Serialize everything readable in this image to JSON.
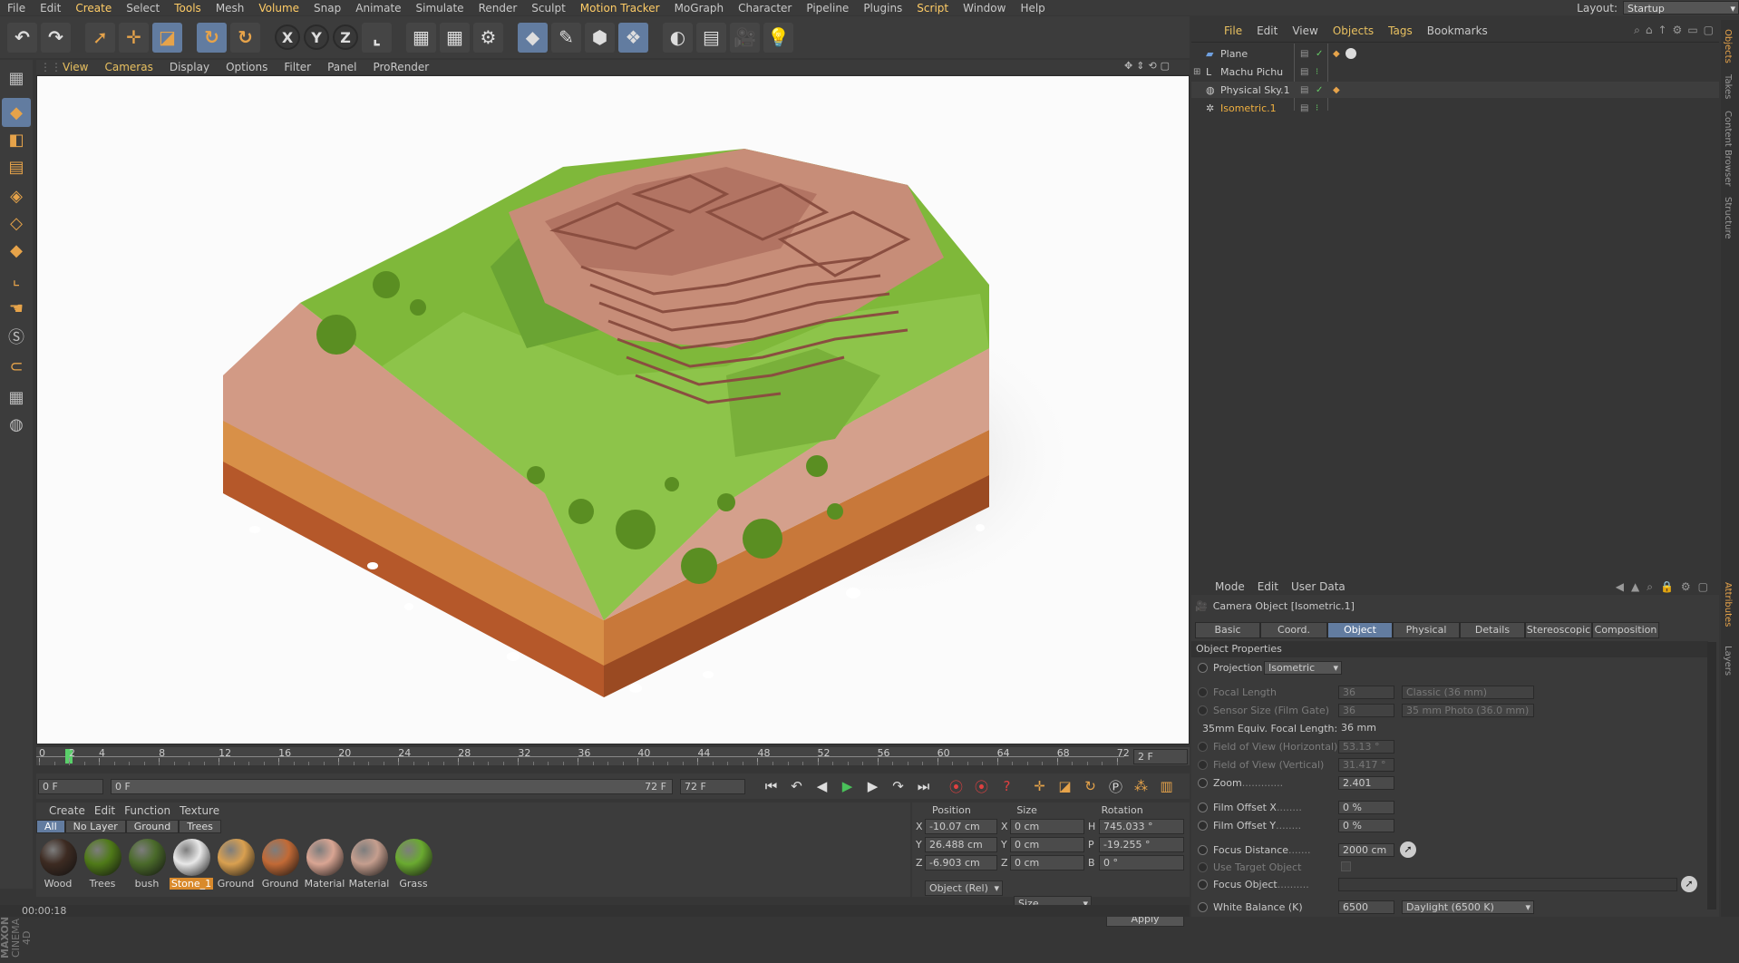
{
  "menubar": {
    "items": [
      "File",
      "Edit",
      "Create",
      "Select",
      "Tools",
      "Mesh",
      "Volume",
      "Snap",
      "Animate",
      "Simulate",
      "Render",
      "Sculpt",
      "Motion Tracker",
      "MoGraph",
      "Character",
      "Pipeline",
      "Plugins",
      "Script",
      "Window",
      "Help"
    ],
    "highlighted": [
      "Create",
      "Tools",
      "Volume",
      "Motion Tracker",
      "Script"
    ],
    "layout_label": "Layout:",
    "layout_value": "Startup"
  },
  "toolbar": {
    "buttons": [
      {
        "name": "undo-icon",
        "glyph": "↶"
      },
      {
        "name": "redo-icon",
        "glyph": "↷"
      },
      {
        "name": "live-selection-icon",
        "glyph": "➚"
      },
      {
        "name": "move-icon",
        "glyph": "✛"
      },
      {
        "name": "scale-icon",
        "glyph": "◪"
      },
      {
        "name": "rotate-icon",
        "glyph": "↻"
      },
      {
        "name": "recent-tool-icon",
        "glyph": "↻"
      },
      {
        "name": "x-axis-icon",
        "glyph": "X"
      },
      {
        "name": "y-axis-icon",
        "glyph": "Y"
      },
      {
        "name": "z-axis-icon",
        "glyph": "Z"
      },
      {
        "name": "coordinate-system-icon",
        "glyph": "⌞"
      },
      {
        "name": "render-view-icon",
        "glyph": "▦"
      },
      {
        "name": "render-picture-viewer-icon",
        "glyph": "▦"
      },
      {
        "name": "render-settings-icon",
        "glyph": "⚙"
      },
      {
        "name": "cube-icon",
        "glyph": "◆"
      },
      {
        "name": "pen-icon",
        "glyph": "✎"
      },
      {
        "name": "subdivision-icon",
        "glyph": "⬢"
      },
      {
        "name": "array-icon",
        "glyph": "❖"
      },
      {
        "name": "deformer-icon",
        "glyph": "◐"
      },
      {
        "name": "floor-icon",
        "glyph": "▤"
      },
      {
        "name": "camera-icon",
        "glyph": "🎥"
      },
      {
        "name": "light-icon",
        "glyph": "💡"
      }
    ]
  },
  "left_toolbar": {
    "icons": [
      "make-editable-icon",
      "model-mode-icon",
      "texture-mode-icon",
      "workplane-icon",
      "points-mode-icon",
      "edges-mode-icon",
      "polygons-mode-icon",
      "axis-icon",
      "tweak-icon",
      "snap-icon",
      "magnet-icon",
      "grid-lock-icon",
      "soft-selection-icon"
    ]
  },
  "viewport": {
    "menu": [
      "View",
      "Cameras",
      "Display",
      "Options",
      "Filter",
      "Panel",
      "ProRender"
    ],
    "highlighted": [
      "View",
      "Cameras"
    ]
  },
  "timeline": {
    "ticks": [
      "0",
      "2",
      "4",
      "8",
      "12",
      "16",
      "20",
      "24",
      "28",
      "32",
      "36",
      "40",
      "44",
      "48",
      "52",
      "56",
      "60",
      "64",
      "68",
      "72"
    ],
    "end_field": "2 F",
    "current_frame": 2
  },
  "controls": {
    "start": "0 F",
    "range_start": "0 F",
    "range_end": "72 F",
    "end": "72 F"
  },
  "materials": {
    "menu": [
      "Create",
      "Edit",
      "Function",
      "Texture"
    ],
    "filters": [
      "All",
      "No Layer",
      "Ground",
      "Trees"
    ],
    "items": [
      {
        "name": "Wood",
        "color": "#3d2b22"
      },
      {
        "name": "Trees",
        "color": "#4f7a18"
      },
      {
        "name": "bush",
        "color": "#4a6a2a"
      },
      {
        "name": "Stone_1",
        "color": "#e8e8e8",
        "selected": true
      },
      {
        "name": "Ground",
        "color": "#d9a050"
      },
      {
        "name": "Ground",
        "color": "#c26a36"
      },
      {
        "name": "Material",
        "color": "#d9a593"
      },
      {
        "name": "Material",
        "color": "#c59e8e"
      },
      {
        "name": "Grass",
        "color": "#6aaa30"
      }
    ]
  },
  "coords": {
    "headers": [
      "Position",
      "Size",
      "Rotation"
    ],
    "rows": [
      {
        "axis": "X",
        "pos": "-10.07 cm",
        "size": "0 cm",
        "rlabel": "H",
        "rot": "745.033 °"
      },
      {
        "axis": "Y",
        "pos": "26.488 cm",
        "size": "0 cm",
        "rlabel": "P",
        "rot": "-19.255 °"
      },
      {
        "axis": "Z",
        "pos": "-6.903 cm",
        "size": "0 cm",
        "rlabel": "B",
        "rot": "0 °"
      }
    ],
    "mode": "Object (Rel)",
    "size_mode": "Size",
    "apply": "Apply"
  },
  "status": "00:00:18",
  "objects": {
    "menu": [
      "File",
      "Edit",
      "View",
      "Objects",
      "Tags",
      "Bookmarks"
    ],
    "highlighted": [
      "File",
      "Objects",
      "Tags"
    ],
    "rows": [
      {
        "name": "Plane",
        "selected": false
      },
      {
        "name": "Machu Pichu",
        "selected": false
      },
      {
        "name": "Physical Sky.1",
        "selected": false
      },
      {
        "name": "Isometric.1",
        "selected": true
      }
    ]
  },
  "attributes": {
    "menu": [
      "Mode",
      "Edit",
      "User Data"
    ],
    "title": "Camera Object [Isometric.1]",
    "tabs": [
      "Basic",
      "Coord.",
      "Object",
      "Physical",
      "Details",
      "Stereoscopic",
      "Composition"
    ],
    "active_tab": "Object",
    "section": "Object Properties",
    "projection_label": "Projection",
    "projection_value": "Isometric",
    "focal_length_label": "Focal Length",
    "focal_length_value": "36",
    "focal_length_preset": "Classic (36 mm)",
    "sensor_label": "Sensor Size (Film Gate)",
    "sensor_value": "36",
    "sensor_preset": "35 mm Photo (36.0 mm)",
    "equiv_label": "35mm Equiv. Focal Length:",
    "equiv_value": "36 mm",
    "fovh_label": "Field of View (Horizontal)",
    "fovh_value": "53.13 °",
    "fovv_label": "Field of View (Vertical)",
    "fovv_value": "31.417 °",
    "zoom_label": "Zoom",
    "zoom_value": "2.401",
    "offx_label": "Film Offset X",
    "offx_value": "0 %",
    "offy_label": "Film Offset Y",
    "offy_value": "0 %",
    "focus_label": "Focus Distance",
    "focus_value": "2000 cm",
    "target_label": "Use Target Object",
    "focusobj_label": "Focus Object",
    "wb_label": "White Balance (K)",
    "wb_value": "6500",
    "wb_preset": "Daylight (6500 K)"
  },
  "right_strip": [
    "Objects",
    "Takes",
    "Content Browser",
    "Structure",
    "Attributes",
    "Layers"
  ],
  "logo": {
    "line1": "MAXON",
    "line2": "CINEMA 4D"
  }
}
